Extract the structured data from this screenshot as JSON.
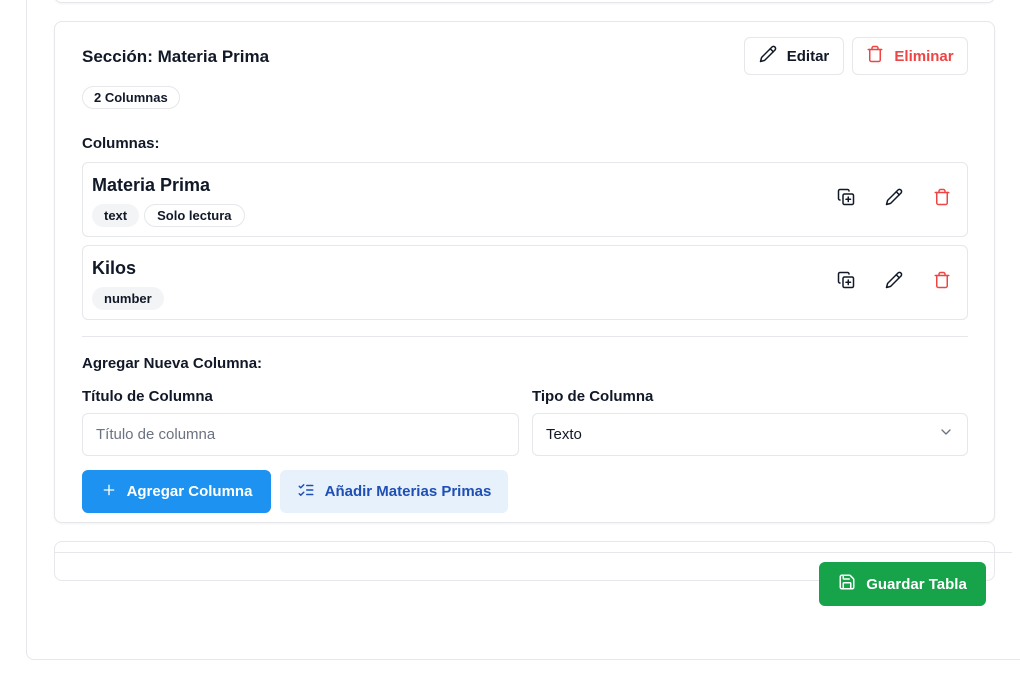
{
  "section": {
    "title": "Sección: Materia Prima",
    "edit_label": "Editar",
    "delete_label": "Eliminar",
    "column_count": "2 Columnas",
    "columns_label": "Columnas:",
    "columns": [
      {
        "title": "Materia Prima",
        "type": "text",
        "readonly_label": "Solo lectura"
      },
      {
        "title": "Kilos",
        "type": "number"
      }
    ]
  },
  "add_column": {
    "heading": "Agregar Nueva Columna:",
    "title_label": "Título de Columna",
    "title_placeholder": "Título de columna",
    "type_label": "Tipo de Columna",
    "type_value": "Texto",
    "add_button": "Agregar Columna",
    "add_materials_button": "Añadir Materias Primas"
  },
  "footer": {
    "save_button": "Guardar Tabla"
  },
  "colors": {
    "primary": "#1d92f0",
    "danger": "#ef4444",
    "success": "#16a34a",
    "secondary_bg": "#e6f1fc"
  }
}
